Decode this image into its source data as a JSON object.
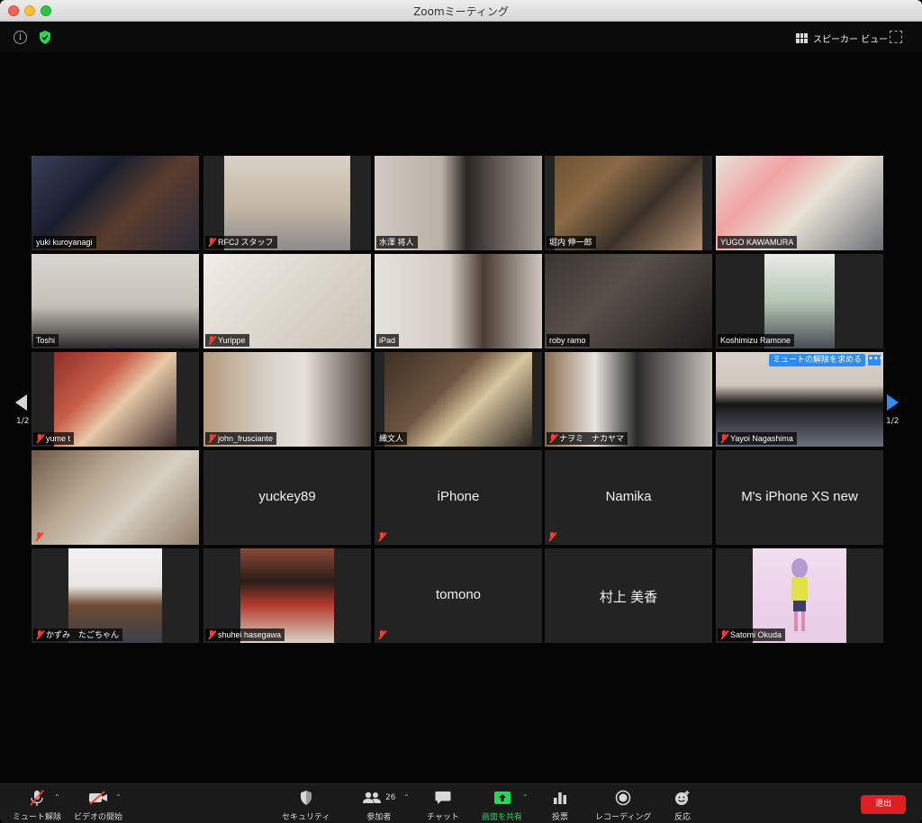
{
  "window": {
    "title": "Zoomミーティング"
  },
  "top_bar": {
    "speaker_view_label": "スピーカー ビュー"
  },
  "gallery": {
    "page_left": "1/2",
    "page_right": "1/2",
    "unmute_banner": "ミュートの解除を求める",
    "more_label": "•••",
    "tiles": [
      {
        "name": "yuki kuroyanagi",
        "muted": false,
        "active": true
      },
      {
        "name": "RFCJ スタッフ",
        "muted": true
      },
      {
        "name": "水澤 将人",
        "muted": false
      },
      {
        "name": "堀内 伸一郎",
        "muted": false
      },
      {
        "name": "YUGO KAWAMURA",
        "muted": false
      },
      {
        "name": "Toshi",
        "muted": false
      },
      {
        "name": "Yurippe",
        "muted": true
      },
      {
        "name": "iPad",
        "muted": false
      },
      {
        "name": "roby ramo",
        "muted": false
      },
      {
        "name": "Koshimizu Ramone",
        "muted": false
      },
      {
        "name": "yume t",
        "muted": true
      },
      {
        "name": "john_frusciante",
        "muted": true
      },
      {
        "name": "織文人",
        "muted": false
      },
      {
        "name": "ナヲミ　ナカヤマ",
        "muted": true
      },
      {
        "name": "Yayoi Nagashima",
        "muted": true
      },
      {
        "name": "",
        "muted": true
      },
      {
        "name": "yuckey89",
        "muted": false,
        "video_off": true
      },
      {
        "name": "iPhone",
        "muted": true,
        "video_off": true
      },
      {
        "name": "Namika",
        "muted": true,
        "video_off": true
      },
      {
        "name": "M's iPhone XS new",
        "muted": false,
        "video_off": true
      },
      {
        "name": "かずみ　たごちゃん",
        "muted": true
      },
      {
        "name": "shuhei hasegawa",
        "muted": true
      },
      {
        "name": "tomono",
        "muted": true,
        "video_off": true
      },
      {
        "name": "村上 美香",
        "muted": false,
        "video_off": true
      },
      {
        "name": "Satomi Okuda",
        "muted": true
      }
    ]
  },
  "toolbar": {
    "unmute": "ミュート解除",
    "start_video": "ビデオの開始",
    "security": "セキュリティ",
    "participants": "参加者",
    "participants_count": "26",
    "chat": "チャット",
    "share_screen": "画面を共有",
    "poll": "投票",
    "record": "レコーディング",
    "reactions": "反応",
    "leave": "退出"
  },
  "colors": {
    "accent_blue": "#2d8cff",
    "active_speaker": "#d7e52b",
    "leave_red": "#e02020",
    "share_green": "#23d959",
    "mute_red": "#ff3b30"
  }
}
